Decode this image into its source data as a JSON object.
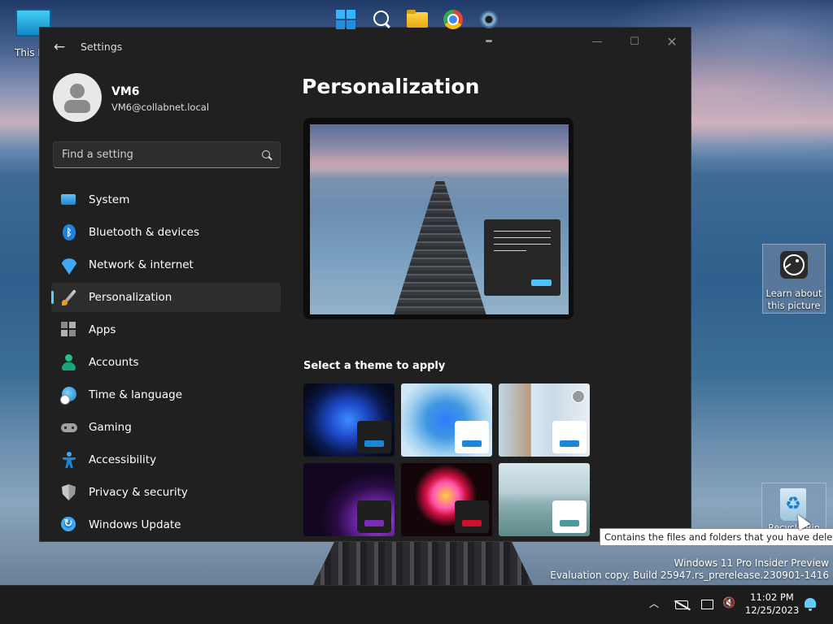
{
  "desktop": {
    "pc_icon_label": "This PC",
    "learn_label": "Learn about this picture",
    "recycle_label": "Recycle Bin",
    "tooltip": "Contains the files and folders that you have deleted.",
    "watermark_line1": "Windows 11 Pro Insider Preview",
    "watermark_line2": "Evaluation copy. Build 25947.rs_prerelease.230901-1416"
  },
  "window": {
    "app_title": "Settings",
    "back_icon": "back-arrow-icon",
    "controls": [
      "minimize",
      "maximize",
      "close"
    ]
  },
  "profile": {
    "name": "VM6",
    "email": "VM6@collabnet.local"
  },
  "search": {
    "placeholder": "Find a setting"
  },
  "sidebar": {
    "items": [
      {
        "label": "System",
        "icon": "system-icon"
      },
      {
        "label": "Bluetooth & devices",
        "icon": "bluetooth-icon"
      },
      {
        "label": "Network & internet",
        "icon": "wifi-icon"
      },
      {
        "label": "Personalization",
        "icon": "brush-icon",
        "active": true
      },
      {
        "label": "Apps",
        "icon": "apps-icon"
      },
      {
        "label": "Accounts",
        "icon": "account-icon"
      },
      {
        "label": "Time & language",
        "icon": "globe-clock-icon"
      },
      {
        "label": "Gaming",
        "icon": "controller-icon"
      },
      {
        "label": "Accessibility",
        "icon": "accessibility-icon"
      },
      {
        "label": "Privacy & security",
        "icon": "shield-icon"
      },
      {
        "label": "Windows Update",
        "icon": "update-icon"
      }
    ]
  },
  "main": {
    "title": "Personalization",
    "themes_label": "Select a theme to apply",
    "themes": [
      {
        "name": "windows-dark",
        "accent": "#1a86d9"
      },
      {
        "name": "windows-light",
        "accent": "#1a86d9"
      },
      {
        "name": "windows-spotlight",
        "accent": "#1a86d9"
      },
      {
        "name": "glow",
        "accent": "#7a2bb8"
      },
      {
        "name": "captured-motion",
        "accent": "#d0102a"
      },
      {
        "name": "flow",
        "accent": "#4a9aa0"
      }
    ]
  },
  "taskbar": {
    "apps": [
      "start",
      "search",
      "file-explorer",
      "chrome",
      "settings"
    ],
    "time": "11:02 PM",
    "date": "12/25/2023"
  },
  "colors": {
    "accent": "#60cdff",
    "window_bg": "#202020"
  }
}
